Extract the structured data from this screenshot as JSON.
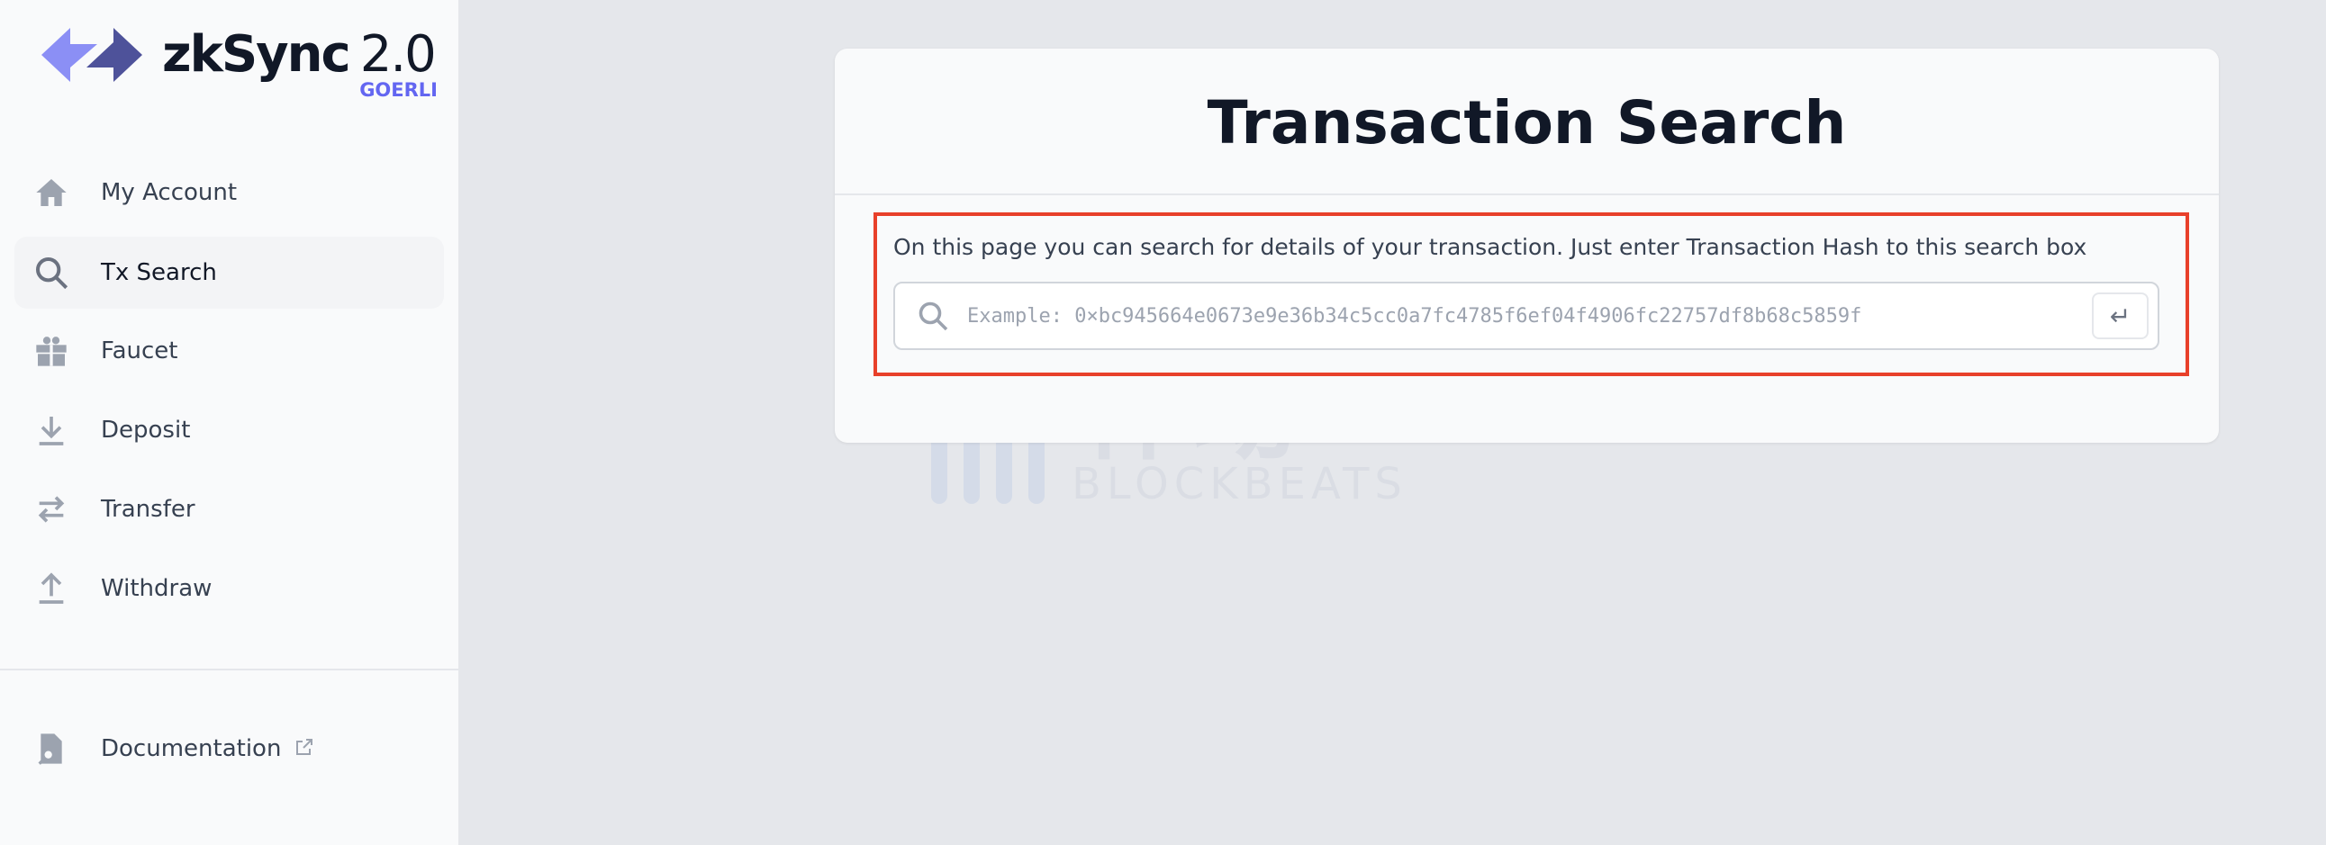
{
  "brand": {
    "name": "zkSync",
    "version": "2.0",
    "network": "GOERLI",
    "colors": {
      "arrow_light": "#8b8ff5",
      "arrow_dark": "#4e529a",
      "network": "#6366f1"
    }
  },
  "sidebar": {
    "items": [
      {
        "label": "My Account",
        "icon": "home-icon"
      },
      {
        "label": "Tx Search",
        "icon": "search-icon",
        "active": true
      },
      {
        "label": "Faucet",
        "icon": "gift-icon"
      },
      {
        "label": "Deposit",
        "icon": "download-icon"
      },
      {
        "label": "Transfer",
        "icon": "arrows-exchange-icon"
      },
      {
        "label": "Withdraw",
        "icon": "upload-icon"
      }
    ],
    "footer": {
      "label": "Documentation",
      "icon": "document-search-icon",
      "external_icon": "external-link-icon"
    }
  },
  "main": {
    "title": "Transaction Search",
    "description": "On this page you can search for details of your transaction. Just enter Transaction Hash to this search box",
    "search": {
      "value": "",
      "placeholder": "Example: 0×bc945664e0673e9e36b34c5cc0a7fc4785f6ef04f4906fc22757df8b68c5859f",
      "enter_icon": "↵"
    },
    "highlight_color": "#e8402a"
  },
  "watermark": {
    "cn": "律动",
    "en": "BLOCKBEATS"
  }
}
